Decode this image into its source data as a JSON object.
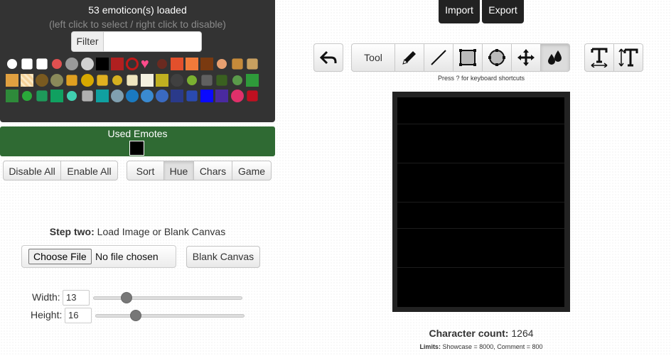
{
  "emote_panel": {
    "title": "53 emoticon(s) loaded",
    "hint": "(left click to select / right click to disable)",
    "filter_label": "Filter",
    "filter_value": ""
  },
  "used_emotes": {
    "title": "Used Emotes",
    "swatch_color": "#000000"
  },
  "actions": {
    "disable_all": "Disable All",
    "enable_all": "Enable All"
  },
  "sort": {
    "label": "Sort",
    "options": [
      "Hue",
      "Chars",
      "Game"
    ],
    "selected": "Hue"
  },
  "step_two": {
    "bold": "Step two:",
    "text": " Load Image or Blank Canvas",
    "choose_file": "Choose File",
    "no_file": "No file chosen",
    "blank_canvas": "Blank Canvas"
  },
  "dimensions": {
    "width_label": "Width:",
    "width_value": "13",
    "width_slider_level": 0.2,
    "height_label": "Height:",
    "height_value": "16",
    "height_slider_level": 0.25
  },
  "top": {
    "import": "Import",
    "export": "Export"
  },
  "toolbar": {
    "tool_label": "Tool",
    "tools": [
      "pencil-icon",
      "line-icon",
      "rectangle-icon",
      "circle-icon",
      "move-icon",
      "fill-drops-icon"
    ],
    "active_tool": "fill-drops-icon",
    "shortcut_note": "Press ? for keyboard shortcuts"
  },
  "stats": {
    "char_count_label": "Character count:",
    "char_count_value": " 1264",
    "limits_label": "Limits:",
    "limits_text": " Showcase = 8000, Comment = 800"
  },
  "emotes": [
    [
      "#ffffff",
      "circle"
    ],
    [
      "#ffffff",
      "dove"
    ],
    [
      "#ffffff",
      "cube"
    ],
    [
      "#e05050",
      "circle"
    ],
    [
      "#9a9a9a",
      "face"
    ],
    [
      "#d0d0d0",
      "panda"
    ],
    [
      "#000000",
      "square"
    ],
    [
      "#b02020",
      "square"
    ],
    [
      "#c01818",
      "ring"
    ],
    [
      "#ff4b8b",
      "heart"
    ],
    [
      "#6a2a20",
      "circle"
    ],
    [
      "#e2502c",
      "square"
    ],
    [
      "#f07a3a",
      "square"
    ],
    [
      "#7a3a10",
      "square"
    ],
    [
      "#e8a070",
      "circle"
    ],
    [
      "#c58a3a",
      "rabbit"
    ],
    [
      "#c8a060",
      "bird"
    ],
    [
      "#e0a040",
      "square"
    ],
    [
      "#f5d29a",
      "striped"
    ],
    [
      "#7a5a20",
      "cat"
    ],
    [
      "#8a8a5a",
      "face"
    ],
    [
      "#e0a020",
      "bird"
    ],
    [
      "#d6a800",
      "face"
    ],
    [
      "#e0b020",
      "thumb"
    ],
    [
      "#d4b020",
      "circle"
    ],
    [
      "#efe6c0",
      "map"
    ],
    [
      "#f3f0e0",
      "square"
    ],
    [
      "#c0b020",
      "square"
    ],
    [
      "#404040",
      "face"
    ],
    [
      "#7ab030",
      "circle"
    ],
    [
      "#606060",
      "robot"
    ],
    [
      "#3a6020",
      "bug"
    ],
    [
      "#5a9a4a",
      "circle"
    ],
    [
      "#2e9a3a",
      "square"
    ],
    [
      "#2e8a3a",
      "square"
    ],
    [
      "#2aaa3a",
      "circle"
    ],
    [
      "#1e9a5a",
      "skull"
    ],
    [
      "#10a060",
      "square"
    ],
    [
      "#40d0b0",
      "circle"
    ],
    [
      "#b0b0b0",
      "bat"
    ],
    [
      "#10a0a0",
      "square"
    ],
    [
      "#80a0b0",
      "gear"
    ],
    [
      "#1a7ac0",
      "face"
    ],
    [
      "#3a8ad0",
      "cat"
    ],
    [
      "#3a6ac0",
      "face"
    ],
    [
      "#2a3a8a",
      "square"
    ],
    [
      "#2a4ab0",
      "sonic"
    ],
    [
      "#0a0aff",
      "square"
    ],
    [
      "#4a2aa0",
      "square"
    ],
    [
      "#e0306a",
      "ghost"
    ],
    [
      "#c01020",
      "rune"
    ]
  ]
}
